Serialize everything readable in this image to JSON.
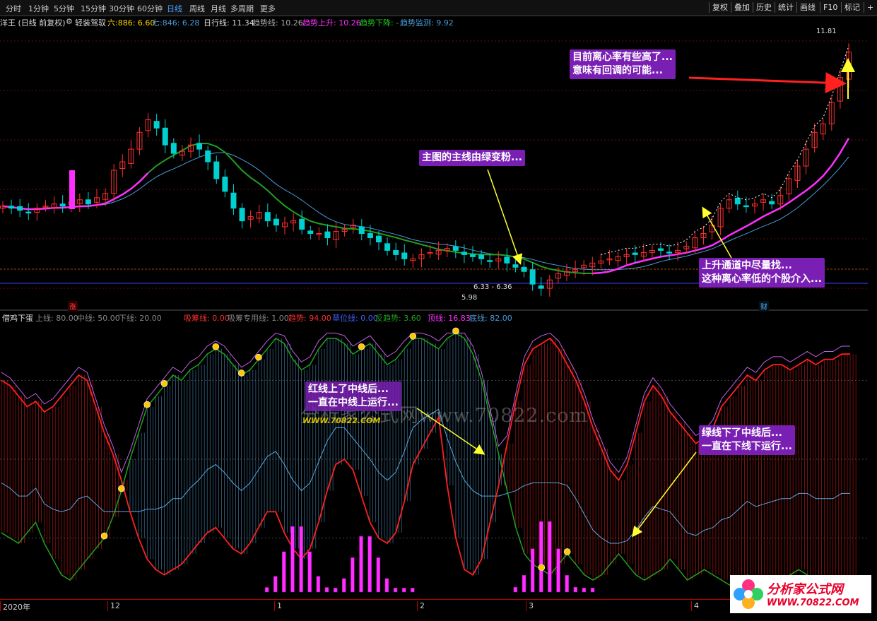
{
  "toolbar": {
    "timeframes": [
      "分时",
      "1分钟",
      "5分钟",
      "15分钟",
      "30分钟",
      "60分钟",
      "日线",
      "周线",
      "月线",
      "多周期",
      "更多"
    ],
    "active_timeframe": "日线",
    "right_buttons": [
      "复权",
      "叠加",
      "历史",
      "统计",
      "画线",
      "F10",
      "标记",
      "+"
    ]
  },
  "info_bar": {
    "stock": "洋王 (日线 前复权)",
    "indicator_name": "轻装驾驭",
    "ma6": "六:886: 6.60",
    "ma7": "七:846: 6.28",
    "daily_line": "日行线: 11.34",
    "trend_line": "趋势线: 10.26",
    "trend_up": "趋势上升: 10.26",
    "trend_down": "趋势下降: -",
    "trend_monitor": "趋势监测: 9.92"
  },
  "price_labels": {
    "high": "11.81",
    "range": "6.33 - 6.36",
    "low": "5.98"
  },
  "badges": {
    "zhang": "涨",
    "cai": "财"
  },
  "indicator_bar": {
    "name": "借鸡下蛋",
    "upper": "上线: 80.00",
    "middle": "中线: 50.00",
    "lower": "下线: 20.00",
    "absorb": "吸筹线: 0.00",
    "absorb_special": "吸筹专用线: 1.00",
    "trend": "趋势: 94.00",
    "grass": "草位线: 0.00",
    "reverse": "反趋势: 3.60",
    "top": "顶线: 16.83",
    "bottom": "底线: 82.00"
  },
  "x_axis_ticks": [
    "2020年",
    "12",
    "1",
    "2",
    "3",
    "4"
  ],
  "callouts": {
    "main_top": [
      "目前离心率有些高了...",
      "意味有回调的可能..."
    ],
    "main_mid": [
      "主图的主线由绿变粉..."
    ],
    "main_right": [
      "上升通道中尽量找...",
      "这种离心率低的个股介入..."
    ],
    "ind_left": [
      "红线上了中线后...",
      "一直在中线上运行..."
    ],
    "ind_right": [
      "绿线下了中线后...",
      "一直在下线下运行..."
    ]
  },
  "watermark": {
    "text": "分析家公式网www.70822.com",
    "url": "WWW.70822.COM"
  },
  "logo": {
    "title": "分析家公式网",
    "url": "WWW.70822.COM"
  },
  "colors": {
    "up": "#ff3030",
    "down": "#00d0d0",
    "ma_pink": "#ff30ff",
    "ma_green": "#20a020",
    "ma_blue": "#4a9ad8",
    "callout_bg": "#7a1fb3",
    "indicator_red": "#ff2020",
    "indicator_green": "#20a020",
    "indicator_blue": "#5aa8e0",
    "indicator_purple": "#c060e0"
  },
  "chart_data": [
    {
      "type": "candlestick",
      "title": "",
      "n_bars": 100,
      "ylim": [
        5.5,
        12.2
      ],
      "price_levels_shown": [
        11.81,
        6.36,
        6.33,
        5.98
      ],
      "close": [
        7.95,
        7.9,
        7.85,
        7.8,
        7.9,
        7.95,
        8.0,
        7.95,
        8.05,
        8.1,
        8.0,
        8.15,
        8.25,
        8.8,
        9.0,
        9.3,
        9.7,
        10.0,
        9.8,
        9.4,
        9.2,
        9.25,
        9.4,
        9.3,
        9.0,
        8.6,
        8.3,
        7.9,
        7.6,
        7.7,
        7.8,
        7.6,
        7.5,
        7.55,
        7.6,
        7.4,
        7.3,
        7.3,
        7.2,
        7.35,
        7.4,
        7.5,
        7.3,
        7.2,
        7.1,
        6.9,
        6.8,
        6.7,
        6.7,
        6.8,
        6.85,
        6.9,
        6.95,
        6.9,
        6.8,
        6.75,
        6.7,
        6.65,
        6.7,
        6.6,
        6.5,
        6.4,
        6.1,
        6.0,
        6.2,
        6.35,
        6.4,
        6.45,
        6.55,
        6.6,
        6.65,
        6.7,
        6.75,
        6.8,
        6.8,
        6.85,
        6.9,
        6.9,
        6.85,
        6.9,
        7.0,
        7.2,
        7.3,
        7.5,
        7.9,
        8.1,
        8.0,
        7.95,
        8.0,
        8.1,
        8.0,
        8.2,
        8.6,
        8.9,
        9.3,
        9.7,
        9.9,
        10.4,
        11.0,
        11.6
      ],
      "series_lines": [
        "pink main line",
        "green line",
        "blue line"
      ]
    },
    {
      "type": "line",
      "title": "借鸡下蛋",
      "ylim": [
        0,
        100
      ],
      "reference_lines": [
        80,
        50,
        20
      ],
      "series": [
        {
          "name": "红线",
          "values": [
            80,
            78,
            74,
            70,
            72,
            68,
            70,
            74,
            78,
            82,
            80,
            70,
            60,
            52,
            42,
            30,
            20,
            12,
            8,
            6,
            8,
            10,
            14,
            18,
            22,
            24,
            20,
            16,
            14,
            18,
            24,
            30,
            30,
            22,
            16,
            12,
            16,
            26,
            38,
            48,
            50,
            46,
            36,
            26,
            20,
            18,
            22,
            34,
            48,
            54,
            60,
            66,
            40,
            20,
            8,
            6,
            12,
            26,
            40,
            56,
            72,
            86,
            92,
            94,
            96,
            92,
            86,
            80,
            72,
            62,
            54,
            46,
            42,
            48,
            60,
            72,
            78,
            74,
            68,
            64,
            60,
            56,
            58,
            62,
            70,
            74,
            78,
            82,
            80,
            84,
            86,
            86,
            84,
            86,
            88,
            86,
            88,
            88,
            90,
            90
          ]
        },
        {
          "name": "绿线",
          "values": [
            22,
            20,
            18,
            22,
            26,
            18,
            12,
            6,
            4,
            8,
            12,
            16,
            20,
            28,
            38,
            50,
            60,
            70,
            74,
            78,
            82,
            80,
            84,
            86,
            90,
            92,
            90,
            86,
            82,
            84,
            88,
            92,
            96,
            94,
            88,
            84,
            86,
            92,
            96,
            96,
            94,
            90,
            92,
            94,
            90,
            86,
            88,
            92,
            96,
            96,
            94,
            92,
            96,
            98,
            96,
            90,
            80,
            66,
            52,
            38,
            24,
            14,
            10,
            8,
            6,
            10,
            14,
            10,
            6,
            4,
            6,
            10,
            14,
            10,
            6,
            4,
            6,
            8,
            12,
            8,
            4,
            6,
            8,
            6,
            4,
            2,
            4,
            6,
            4,
            2,
            2,
            4,
            6,
            8,
            6,
            4,
            2,
            2,
            4,
            4
          ]
        }
      ],
      "histogram_peaks": [
        {
          "bar": 34,
          "value": 26
        },
        {
          "bar": 42,
          "value": 22
        },
        {
          "bar": 63,
          "value": 28
        }
      ]
    }
  ]
}
